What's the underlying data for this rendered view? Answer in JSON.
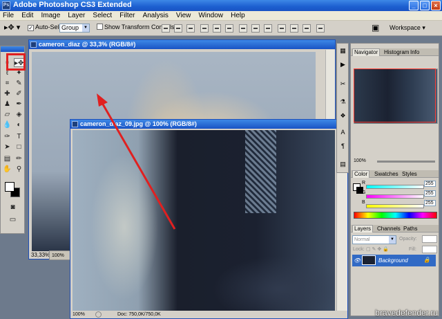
{
  "app": {
    "title": "Adobe Photoshop CS3 Extended",
    "logo": "Ps"
  },
  "menu": [
    "File",
    "Edit",
    "Image",
    "Layer",
    "Select",
    "Filter",
    "Analysis",
    "View",
    "Window",
    "Help"
  ],
  "options": {
    "auto_select_label": "Auto-Select:",
    "auto_select_value": "Group",
    "show_transform_label": "Show Transform Controls",
    "workspace_label": "Workspace ▾"
  },
  "doc1": {
    "title": "cameron_diaz @ 33,3% (RGB/8#)",
    "zoom": "33,33%"
  },
  "doc_minimized": {
    "zoom": "100%"
  },
  "doc2": {
    "title": "cameron_diaz_09.jpg @ 100% (RGB/8#)",
    "zoom": "100%",
    "status": "Doc: 750,0K/750,0K"
  },
  "panels": {
    "navigator_tabs": [
      "Navigator",
      "Histogram",
      "Info"
    ],
    "navigator_zoom": "100%",
    "color_tabs": [
      "Color",
      "Swatches",
      "Styles"
    ],
    "color_rows": [
      {
        "label": "R",
        "value": "255"
      },
      {
        "label": "G",
        "value": "255"
      },
      {
        "label": "B",
        "value": "255"
      }
    ],
    "layers_tabs": [
      "Layers",
      "Channels",
      "Paths"
    ],
    "blend_mode": "Normal",
    "opacity_label": "Opacity:",
    "lock_label": "Lock:",
    "fill_label": "Fill:",
    "layer_name": "Background"
  },
  "watermark": "bravedefender.ru",
  "colors": {
    "title_blue": "#1953c4",
    "highlight": "#e02020",
    "chrome": "#d4d0c8"
  }
}
